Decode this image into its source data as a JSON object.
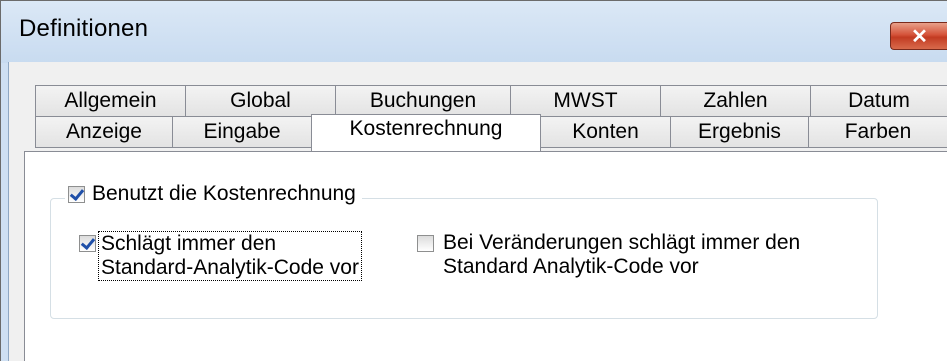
{
  "window": {
    "title": "Definitionen",
    "close_glyph": "✕"
  },
  "tabs": {
    "back_row": [
      "Allgemein",
      "Global",
      "Buchungen",
      "MWST",
      "Zahlen",
      "Datum"
    ],
    "front_row": [
      "Anzeige",
      "Eingabe",
      "Kostenrechnung",
      "Konten",
      "Ergebnis",
      "Farben"
    ],
    "active": "Kostenrechnung"
  },
  "group": {
    "label": "Benutzt die Kostenrechnung",
    "checked": true
  },
  "options": {
    "standard_code": {
      "line1": "Schlägt immer den",
      "line2": "Standard-Analytik-Code vor",
      "checked": true
    },
    "on_change": {
      "line1": "Bei Veränderungen schlägt immer den",
      "line2": "Standard Analytik-Code vor",
      "checked": false
    }
  },
  "colors": {
    "close_button": "#c23b22",
    "titlebar": "#cfe0f3",
    "check_mark": "#1f4fa8"
  }
}
